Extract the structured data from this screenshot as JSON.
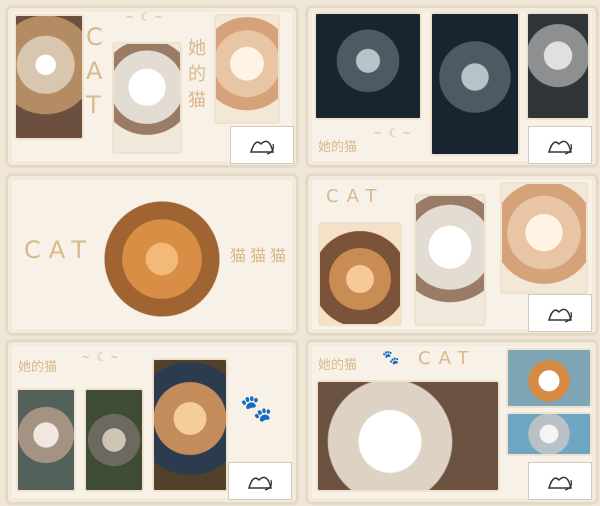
{
  "boards": [
    {
      "cat_text": "CAT",
      "cjk": "她的猫",
      "logo": "cat-logo"
    },
    {
      "cjk": "她的猫",
      "logo": "cat-logo"
    },
    {
      "cat_text": "CAT",
      "cjk": "猫猫猫"
    },
    {
      "cat_text": "CAT",
      "logo": "cat-logo"
    },
    {
      "cjk": "她的猫",
      "logo": "cat-logo"
    },
    {
      "cjk": "她的猫",
      "cat_text": "CAT",
      "logo": "cat-logo"
    }
  ],
  "colors": {
    "background": "#efe6d8",
    "board": "#f7f1e7",
    "accent": "#d8b98c"
  }
}
